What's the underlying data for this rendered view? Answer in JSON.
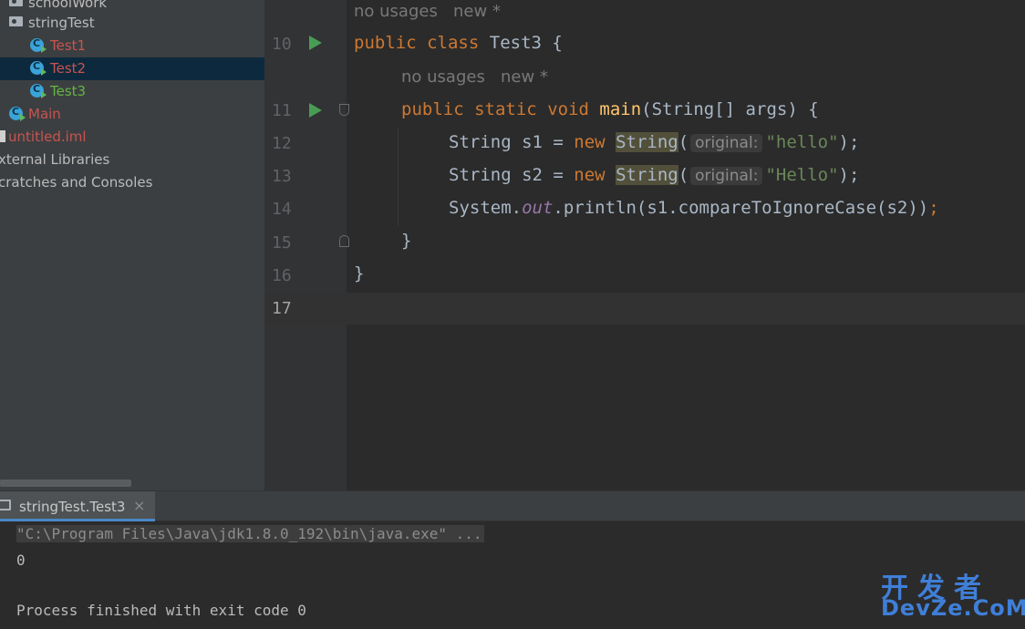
{
  "project_tree": {
    "items": [
      {
        "label": "schoolWork",
        "icon": "folder-icon",
        "color": "#bbbbbb"
      },
      {
        "label": "stringTest",
        "icon": "folder-icon",
        "color": "#bbbbbb"
      },
      {
        "label": "Test1",
        "icon": "java-class-icon",
        "color": "#c75450"
      },
      {
        "label": "Test2",
        "icon": "java-class-icon",
        "color": "#c75450",
        "selected": true
      },
      {
        "label": "Test3",
        "icon": "java-class-icon",
        "color": "#62b543"
      },
      {
        "label": "Main",
        "icon": "java-class-icon",
        "color": "#c75450"
      },
      {
        "label": "untitled.iml",
        "icon": "iml-file-icon",
        "color": "#c75450"
      },
      {
        "label": "xternal Libraries",
        "icon": "",
        "color": "#bbbbbb"
      },
      {
        "label": "cratches and Consoles",
        "icon": "",
        "color": "#bbbbbb"
      }
    ]
  },
  "editor": {
    "lines": [
      {
        "num": "10"
      },
      {
        "num": "11"
      },
      {
        "num": "12"
      },
      {
        "num": "13"
      },
      {
        "num": "14"
      },
      {
        "num": "15"
      },
      {
        "num": "16"
      },
      {
        "num": "17"
      }
    ],
    "hint1": {
      "usages": "no usages",
      "author": "new *"
    },
    "hint2": {
      "usages": "no usages",
      "author": "new *"
    },
    "l10": {
      "kw1": "public",
      "kw2": "class",
      "name": "Test3",
      "brace": " {"
    },
    "l11": {
      "kw1": "public",
      "kw2": "static",
      "kw3": "void",
      "fn": "main",
      "rest": "(String[] args) {"
    },
    "l12": {
      "pre": "String s1 = ",
      "kw": "new",
      "cls": "String",
      "paren": "(",
      "inlay": "original:",
      "str": "\"hello\"",
      "close": ");"
    },
    "l13": {
      "pre": "String s2 = ",
      "kw": "new",
      "cls": "String",
      "paren": "(",
      "inlay": "original:",
      "str": "\"Hello\"",
      "close": ");"
    },
    "l14": {
      "pre": "System.",
      "fld": "out",
      "rest": ".println(s1.compareToIgnoreCase(s2))",
      "semi": ";"
    },
    "l15": {
      "text": "}"
    },
    "l16": {
      "text": "}"
    }
  },
  "run_panel": {
    "tab_label": "stringTest.Test3",
    "tab_close": "×",
    "command": "\"C:\\Program Files\\Java\\jdk1.8.0_192\\bin\\java.exe\" ...",
    "output": "0",
    "exit_message": "Process finished with exit code 0"
  },
  "watermark": {
    "line1": "开发者",
    "line2": "DevZe.CoM"
  }
}
